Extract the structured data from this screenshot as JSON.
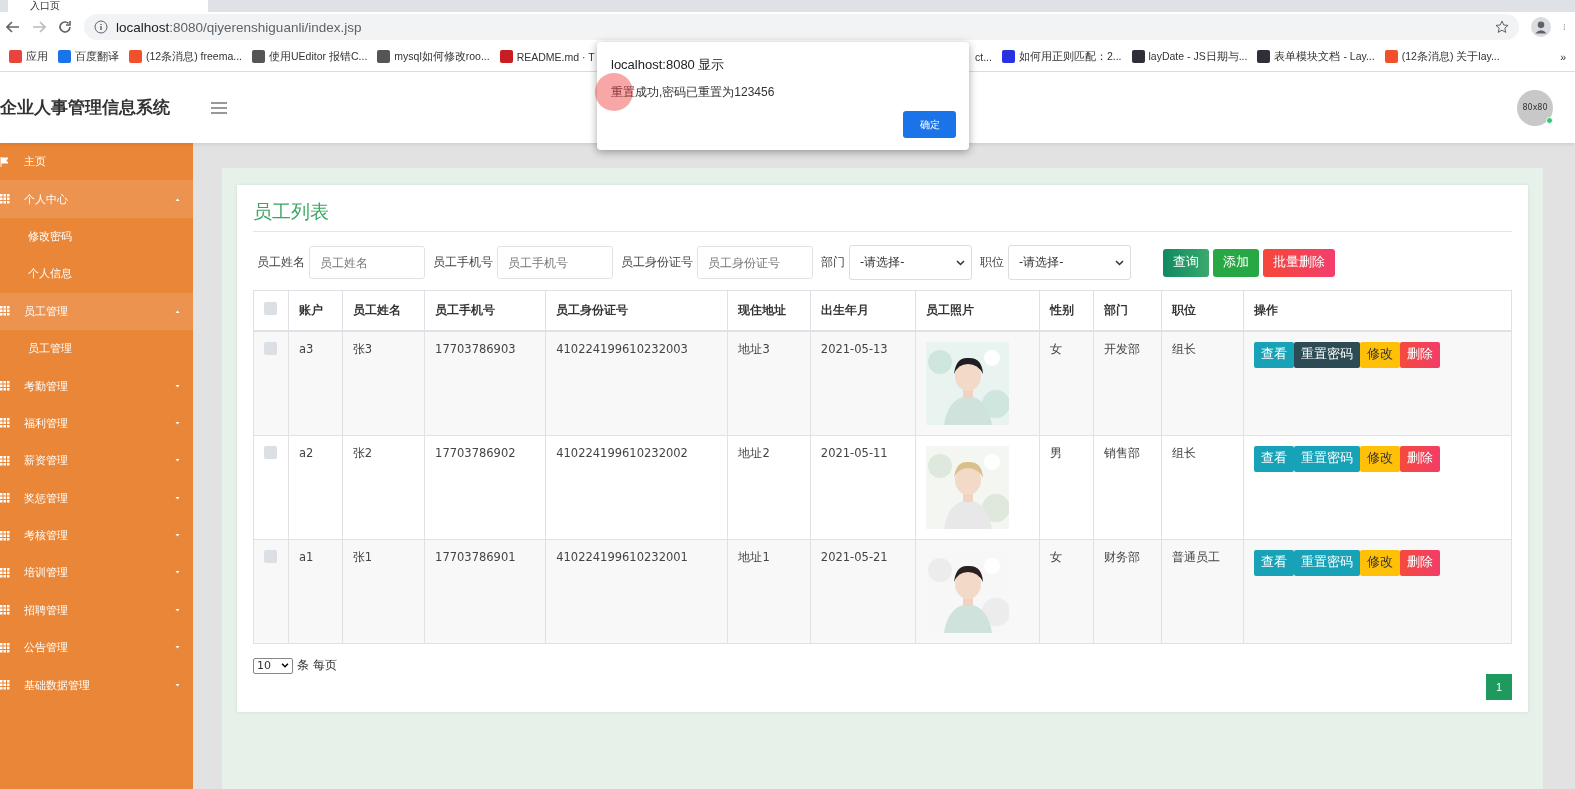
{
  "browser": {
    "tab_title": "入口页",
    "url_host": "localhost",
    "url_rest": ":8080/qiyerenshiguanli/index.jsp",
    "bookmarks": [
      {
        "label": "应用",
        "kind": "apps"
      },
      {
        "label": "百度翻译",
        "kind": "translate"
      },
      {
        "label": "(12条消息) freema...",
        "kind": "csdn"
      },
      {
        "label": "使用UEditor 报错C...",
        "kind": "swirl"
      },
      {
        "label": "mysql如何修改roo...",
        "kind": "swirl"
      },
      {
        "label": "README.md · T",
        "kind": "gitee"
      },
      {
        "label": "ct...",
        "kind": "none"
      },
      {
        "label": "如何用正则匹配：2...",
        "kind": "paw"
      },
      {
        "label": "layDate - JS日期与...",
        "kind": "layui"
      },
      {
        "label": "表单模块文档 - Lay...",
        "kind": "layui"
      },
      {
        "label": "(12条消息) 关于lay...",
        "kind": "csdn"
      }
    ],
    "more": "»"
  },
  "header": {
    "title": "企业人事管理信息系统",
    "avatar": "80x80",
    "online": true
  },
  "sidebar": {
    "items": [
      {
        "label": "主页",
        "kind": "link"
      },
      {
        "label": "个人中心",
        "kind": "group",
        "expanded": true,
        "children": [
          {
            "label": "修改密码"
          },
          {
            "label": "个人信息"
          }
        ]
      },
      {
        "label": "员工管理",
        "kind": "group",
        "expanded": true,
        "children": [
          {
            "label": "员工管理"
          }
        ]
      },
      {
        "label": "考勤管理",
        "kind": "group",
        "expanded": false
      },
      {
        "label": "福利管理",
        "kind": "group",
        "expanded": false
      },
      {
        "label": "薪资管理",
        "kind": "group",
        "expanded": false
      },
      {
        "label": "奖惩管理",
        "kind": "group",
        "expanded": false
      },
      {
        "label": "考核管理",
        "kind": "group",
        "expanded": false
      },
      {
        "label": "培训管理",
        "kind": "group",
        "expanded": false
      },
      {
        "label": "招聘管理",
        "kind": "group",
        "expanded": false
      },
      {
        "label": "公告管理",
        "kind": "group",
        "expanded": false
      },
      {
        "label": "基础数据管理",
        "kind": "group",
        "expanded": false
      }
    ]
  },
  "card": {
    "title": "员工列表",
    "filters": [
      {
        "label": "员工姓名",
        "kind": "input",
        "placeholder": "员工姓名"
      },
      {
        "label": "员工手机号",
        "kind": "input",
        "placeholder": "员工手机号"
      },
      {
        "label": "员工身份证号",
        "kind": "input",
        "placeholder": "员工身份证号"
      },
      {
        "label": "部门",
        "kind": "select",
        "value": "-请选择-"
      },
      {
        "label": "职位",
        "kind": "select",
        "value": "-请选择-"
      }
    ],
    "buttons": [
      {
        "label": "查询",
        "kind": "search"
      },
      {
        "label": "添加",
        "kind": "add"
      },
      {
        "label": "批量删除",
        "kind": "delete"
      }
    ],
    "table": {
      "header_checked": false,
      "columns": [
        {
          "label": "账户",
          "kind": "text"
        },
        {
          "label": "员工姓名",
          "kind": "text"
        },
        {
          "label": "员工手机号",
          "kind": "text"
        },
        {
          "label": "员工身份证号",
          "kind": "text"
        },
        {
          "label": "现住地址",
          "kind": "text"
        },
        {
          "label": "出生年月",
          "kind": "text"
        },
        {
          "label": "员工照片"
        },
        {
          "label": "性别",
          "kind": "text"
        },
        {
          "label": "部门",
          "kind": "text"
        },
        {
          "label": "职位",
          "kind": "text"
        },
        {
          "label": "操作",
          "kind": "actions"
        }
      ],
      "rows": [
        {
          "checked": false,
          "cells": [
            "a3",
            "张3",
            "17703786903",
            "410224199610232003",
            "地址3",
            "2021-05-13",
            "",
            "女",
            "开发部",
            "组长"
          ],
          "reset_focused": true,
          "actions": [
            {
              "label": "查看",
              "kind": "view"
            },
            {
              "label": "重置密码",
              "kind": "reset"
            },
            {
              "label": "修改",
              "kind": "edit"
            },
            {
              "label": "删除",
              "kind": "delete"
            }
          ]
        },
        {
          "checked": false,
          "cells": [
            "a2",
            "张2",
            "17703786902",
            "410224199610232002",
            "地址2",
            "2021-05-11",
            "",
            "男",
            "销售部",
            "组长"
          ],
          "reset_focused": false,
          "actions": [
            {
              "label": "查看",
              "kind": "view"
            },
            {
              "label": "重置密码",
              "kind": "reset"
            },
            {
              "label": "修改",
              "kind": "edit"
            },
            {
              "label": "删除",
              "kind": "delete"
            }
          ]
        },
        {
          "checked": false,
          "cells": [
            "a1",
            "张1",
            "17703786901",
            "410224199610232001",
            "地址1",
            "2021-05-21",
            "",
            "女",
            "财务部",
            "普通员工"
          ],
          "reset_focused": false,
          "actions": [
            {
              "label": "查看",
              "kind": "view"
            },
            {
              "label": "重置密码",
              "kind": "reset"
            },
            {
              "label": "修改",
              "kind": "edit"
            },
            {
              "label": "删除",
              "kind": "delete"
            }
          ]
        }
      ]
    },
    "page_size": "10",
    "page_size_label": "条 每页",
    "pages": [
      {
        "label": "1",
        "selected": true
      }
    ]
  },
  "dialog": {
    "title": "localhost:8080 显示",
    "message": "重置成功,密码已重置为123456",
    "button": "确定"
  }
}
